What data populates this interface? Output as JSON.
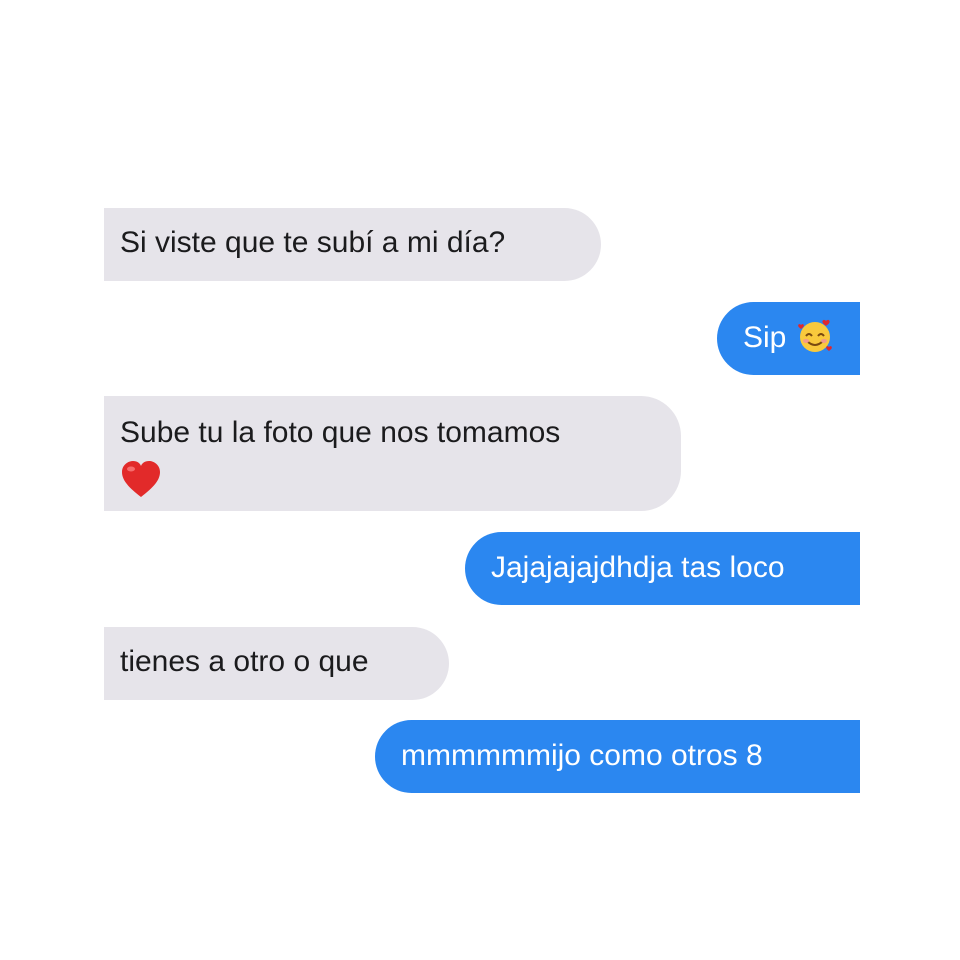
{
  "conversation": {
    "messages": [
      {
        "direction": "incoming",
        "text": "Si viste que te subí a mi día?"
      },
      {
        "direction": "outgoing",
        "text": "Sip",
        "emoji": "smiling-face-with-hearts"
      },
      {
        "direction": "incoming",
        "text": "Sube tu la foto que nos tomamos",
        "emoji": "red-heart"
      },
      {
        "direction": "outgoing",
        "text": "Jajajajajdhdja tas loco"
      },
      {
        "direction": "incoming",
        "text": "tienes a otro o que"
      },
      {
        "direction": "outgoing",
        "text": "mmmmmmijo como otros 8"
      }
    ]
  },
  "colors": {
    "incoming_bubble": "#e6e4ea",
    "outgoing_bubble": "#2b87f0",
    "incoming_text": "#1b1b1d",
    "outgoing_text": "#ffffff"
  }
}
